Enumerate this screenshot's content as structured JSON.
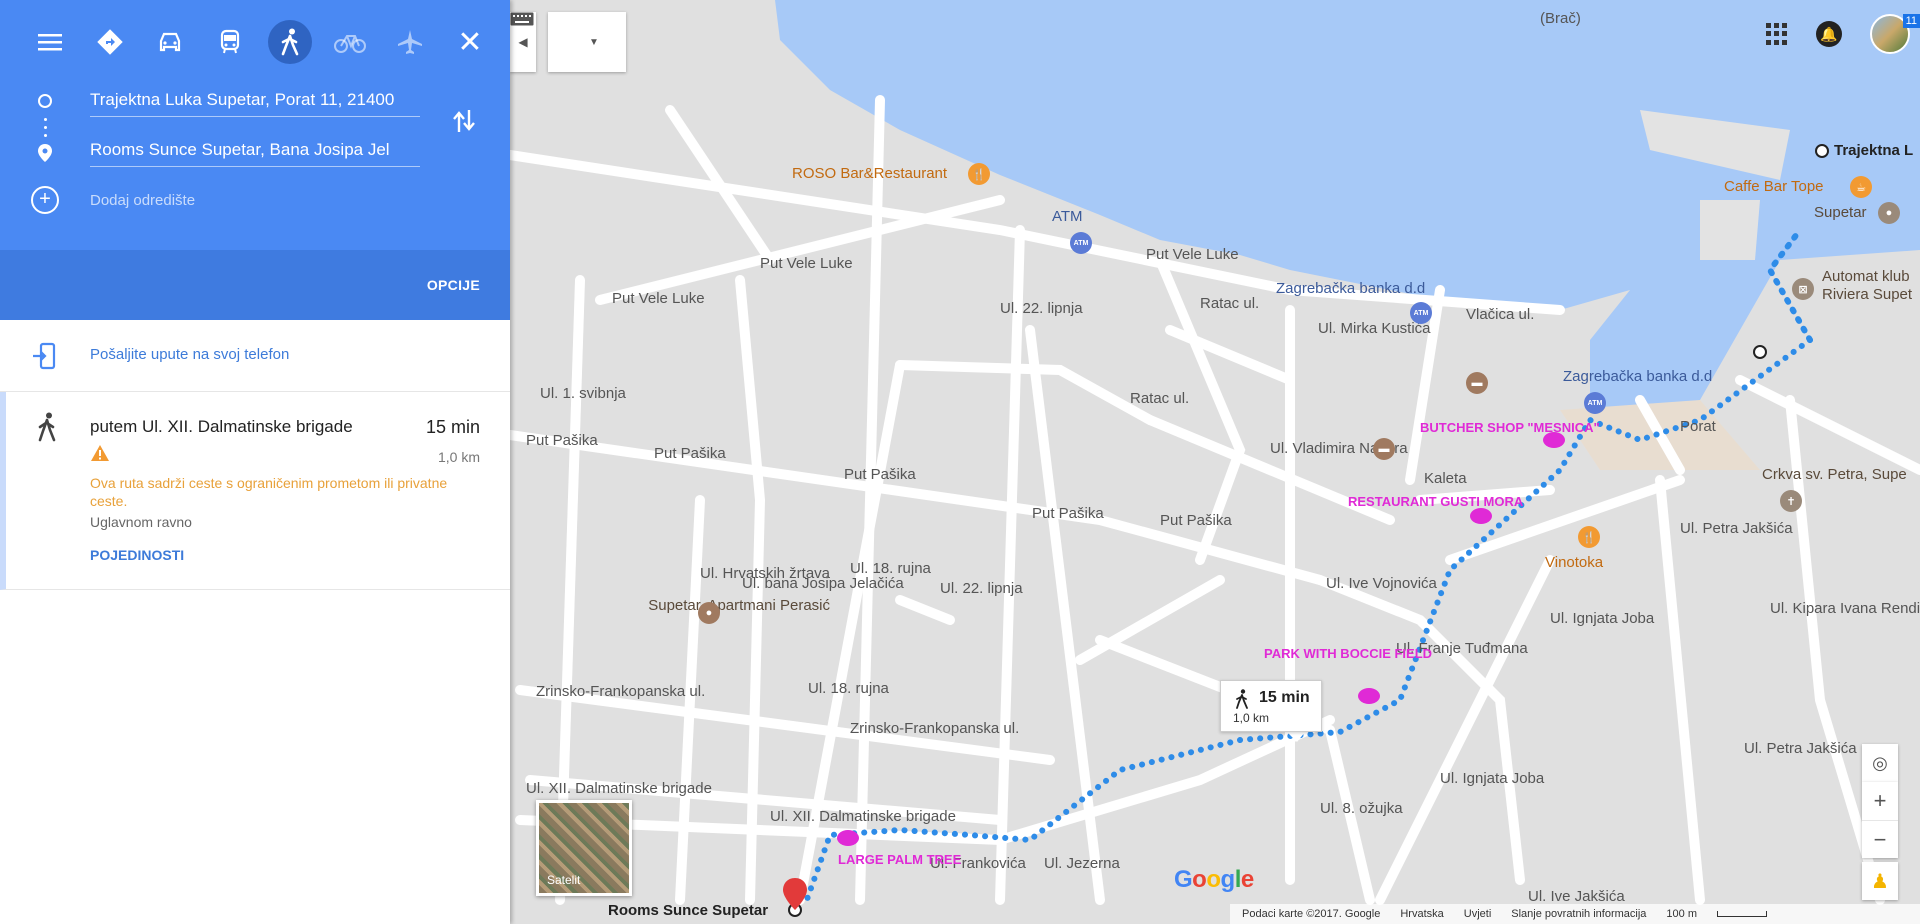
{
  "header": {
    "origin_value": "Trajektna Luka Supetar, Porat 11, 21400",
    "destination_value": "Rooms Sunce Supetar, Bana Josipa Jel",
    "add_destination_placeholder": "Dodaj odredište",
    "options_label": "OPCIJE",
    "travel_modes": [
      "menu",
      "best",
      "driving",
      "transit",
      "walking",
      "bicycling",
      "flights"
    ],
    "active_mode": "walking"
  },
  "send_to_phone": {
    "label": "Pošaljite upute na svoj telefon"
  },
  "route": {
    "via": "putem Ul. XII. Dalmatinske brigade",
    "duration": "15 min",
    "distance": "1,0 km",
    "warning": "Ova ruta sadrži ceste s ograničenim prometom ili privatne ceste.",
    "flatness": "Uglavnom ravno",
    "details_label": "POJEDINOSTI"
  },
  "map": {
    "streets": [
      {
        "label": "Put Vele Luke"
      },
      {
        "label": "Put Vele Luke"
      },
      {
        "label": "Put Vele Luke"
      },
      {
        "label": "Put Pašika"
      },
      {
        "label": "Put Pašika"
      },
      {
        "label": "Put Pašika"
      },
      {
        "label": "Put Pašika"
      },
      {
        "label": "Put Pašika"
      },
      {
        "label": "Zrinsko-Frankopanska ul."
      },
      {
        "label": "Zrinsko-Frankopanska ul."
      },
      {
        "label": "Ul. XII. Dalmatinske brigade"
      },
      {
        "label": "Ul. XII. Dalmatinske brigade"
      },
      {
        "label": "Vlačica ul."
      },
      {
        "label": "Ul. Mirka Kustića"
      },
      {
        "label": "Ul. Ive Vojnovića"
      },
      {
        "label": "Ul. Ive Jakšića"
      },
      {
        "label": "Ratac ul."
      },
      {
        "label": "Ul. Vladimira Nazora"
      },
      {
        "label": "Ul. 22. lipnja"
      },
      {
        "label": "Ul. 22. lipnja"
      },
      {
        "label": "Ul. 18. rujna"
      },
      {
        "label": "Ul. 18. rujna"
      },
      {
        "label": "Ul. bana Josipa Jelačića"
      },
      {
        "label": "Ul. Hrvatskih žrtava"
      },
      {
        "label": "Ul. 1. svibnja"
      },
      {
        "label": "Ul. Petra Jakšića"
      },
      {
        "label": "Ul. Petra Jakšića"
      },
      {
        "label": "Ul. Kipara Ivana Rendića"
      },
      {
        "label": "Ul. Ignjata Joba"
      },
      {
        "label": "Ul. Ignjata Joba"
      },
      {
        "label": "Ul. 8. ožujka"
      },
      {
        "label": "Ul. Jezerna"
      },
      {
        "label": "Ul. Frankovića"
      },
      {
        "label": "Ratac ul."
      },
      {
        "label": "Ul. Franje Tuđmana"
      },
      {
        "label": "Kaleta"
      },
      {
        "label": "Porat"
      },
      {
        "label": "(Brač)"
      }
    ],
    "pois": [
      {
        "label": "ROSO Bar&Restaurant",
        "kind": "food"
      },
      {
        "label": "ATM",
        "kind": "atm"
      },
      {
        "label": "Zagrebačka banka d.d",
        "kind": "atm"
      },
      {
        "label": "Zagrebačka banka d.d",
        "kind": "atm"
      },
      {
        "label": "Trajektna L",
        "kind": "dark"
      },
      {
        "label": "Caffe Bar Tope",
        "kind": "food"
      },
      {
        "label": "Supetar",
        "kind": "gray"
      },
      {
        "label": "Automat klub Riviera Supet",
        "kind": "gray"
      },
      {
        "label": "Crkva sv. Petra, Supe",
        "kind": "gray"
      },
      {
        "label": "Vinotoka",
        "kind": "food"
      },
      {
        "label": "Supetar, Apartmani Perasić",
        "kind": "hotel"
      },
      {
        "label": "Rooms Sunce Supetar",
        "kind": "dark"
      }
    ],
    "annotations": [
      {
        "text": "BUTCHER SHOP \"MESNICA\""
      },
      {
        "text": "RESTAURANT GUSTI MORA"
      },
      {
        "text": "PARK WITH BOCCIE FIELD"
      },
      {
        "text": "LARGE PALM TREE"
      }
    ],
    "route_bubble": {
      "time": "15 min",
      "distance": "1,0 km"
    },
    "satellite_label": "Satelit",
    "google_logo": "Google",
    "footer": [
      "Podaci karte ©2017. Google",
      "Hrvatska",
      "Uvjeti",
      "Slanje povratnih informacija",
      "100 m"
    ],
    "badge": "11",
    "colors": {
      "water": "#a7c9f7",
      "land": "#e0e0e0",
      "road": "#ffffff",
      "route": "#2e8ce8",
      "annotation": "#e02ad6",
      "panel_blue": "#4a89f3"
    }
  }
}
